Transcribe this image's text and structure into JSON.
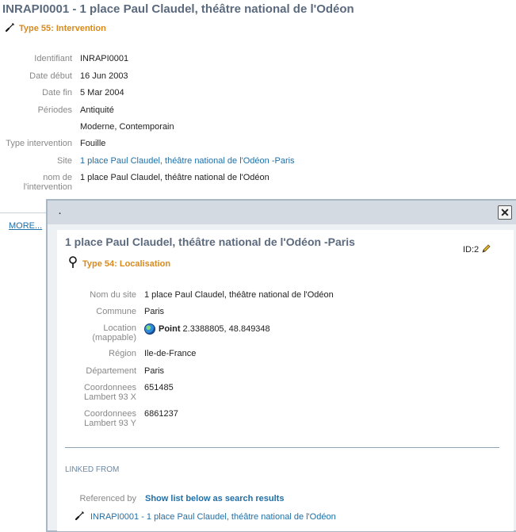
{
  "record": {
    "title": "INRAPI0001 - 1 place Paul Claudel, théâtre national de l'Odéon",
    "type_label": "Type 55: Intervention",
    "fields": [
      {
        "label": "Identifiant",
        "value": "INRAPI0001"
      },
      {
        "label": "Date début",
        "value": "16 Jun 2003"
      },
      {
        "label": "Date fin",
        "value": "5 Mar 2004"
      },
      {
        "label": "Périodes",
        "value": "Antiquité"
      },
      {
        "label": "",
        "value": "Moderne, Contemporain"
      },
      {
        "label": "Type intervention",
        "value": "Fouille"
      },
      {
        "label": "Site",
        "value": "1 place Paul Claudel, théâtre national de l'Odéon -Paris"
      },
      {
        "label_line1": "nom de",
        "label_line2": "l'intervention",
        "value": "1 place Paul Claudel, théâtre national de l'Odéon"
      }
    ],
    "more_label": "MORE..."
  },
  "popup": {
    "header_text": ".",
    "close_label": "✕",
    "title": "1 place Paul Claudel, théâtre national de l'Odéon -Paris",
    "id_label": "ID:2",
    "type_label": "Type 54: Localisation",
    "fields": {
      "nom": {
        "label": "Nom du site",
        "value": "1 place Paul Claudel, théâtre national de l'Odéon"
      },
      "commune": {
        "label": "Commune",
        "value": "Paris"
      },
      "location": {
        "label_line1": "Location",
        "label_line2": "(mappable)",
        "point_label": "Point",
        "value": " 2.3388805, 48.849348"
      },
      "region": {
        "label": "Région",
        "value": "Ile-de-France"
      },
      "departement": {
        "label": "Département",
        "value": "Paris"
      },
      "coordx": {
        "label_line1": "Coordonnees",
        "label_line2": "Lambert 93 X",
        "value": "651485"
      },
      "coordy": {
        "label_line1": "Coordonnees",
        "label_line2": "Lambert 93 Y",
        "value": "6861237"
      }
    },
    "linked_from_label": "LINKED FROM",
    "referenced_by_label": "Referenced by",
    "show_list_label": "Show list below as search results",
    "linked_item": "INRAPI0001 - 1 place Paul Claudel, théâtre national de l'Odéon"
  },
  "icons": {
    "intervention": "trowel-icon",
    "localisation": "map-pin-icon",
    "edit": "pencil-icon",
    "globe": "globe-icon",
    "close": "close-icon"
  },
  "colors": {
    "title": "#5c6a7e",
    "type_label": "#d98a1b",
    "link": "#1f6fa8",
    "popup_bar": "#d3dae1"
  }
}
